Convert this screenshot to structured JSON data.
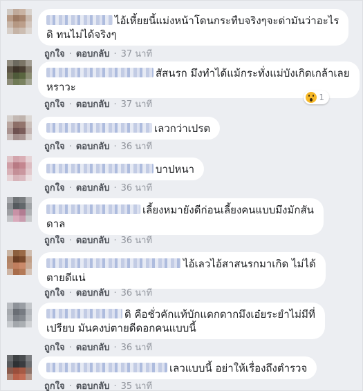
{
  "actions": {
    "like_label": "ถูกใจ",
    "reply_label": "ตอบกลับ",
    "separator": "·"
  },
  "comments": [
    {
      "text_lines": [
        "ไอ้เหี้ยยนี้แม่งหน้าโดนกระทืบจริงๆจะด่ามันว่าอะไร",
        "ดิ ทนไม่ได้จริงๆ"
      ],
      "time": "37 นาที"
    },
    {
      "text_lines": [
        "สัสนรก มึงทำได้แม้กระทั่งแม่บังเกิดเกล้าเลย",
        "หราวะ"
      ],
      "time": "37 นาที",
      "reaction": {
        "icon": "wow-icon",
        "count": "1"
      }
    },
    {
      "text_lines": [
        "เลวกว่าเปรต"
      ],
      "time": "36 นาที"
    },
    {
      "text_lines": [
        "บาปหนา"
      ],
      "time": "36 นาที"
    },
    {
      "text_lines": [
        "เลี้ยงหมายังดีก่อนเลี้ยงคนแบบมึงมักสัน",
        "ดาล"
      ],
      "time": "36 นาที"
    },
    {
      "text_lines": [
        "ไอ้เลวไอ้สาสนรกมาเกิด ไม่ได้",
        "ตายดีแน่"
      ],
      "time": "36 นาที"
    },
    {
      "text_lines": [
        "ดิ คือชั่วคักแท้บักแดกดากมึงเอ๋ยระยำไม่มีที่",
        "เปรียบ มันคงบ่ตายดีดอกคนแบบนี้"
      ],
      "time": "36 นาที"
    },
    {
      "text_lines": [
        "เลวแบบนี้ อย่าให้เรื่องถึงตำรวจ"
      ],
      "time": "35 นาที"
    }
  ]
}
